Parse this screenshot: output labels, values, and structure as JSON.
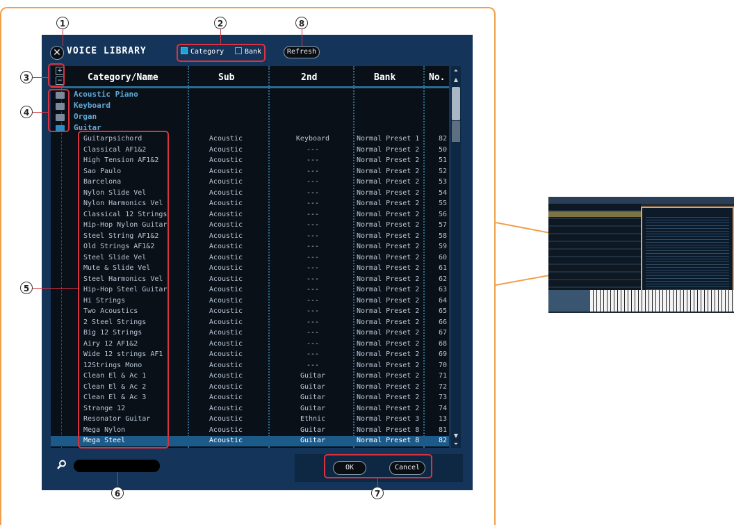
{
  "window": {
    "title": "VOICE LIBRARY",
    "close_glyph": "✕"
  },
  "filters": {
    "category_label": "Category",
    "category_checked": true,
    "bank_label": "Bank",
    "bank_checked": false
  },
  "refresh_label": "Refresh",
  "tree_controls": {
    "expand": "+",
    "collapse": "−"
  },
  "columns": [
    "Category/Name",
    "Sub",
    "2nd",
    "Bank",
    "No."
  ],
  "categories": [
    "Acoustic Piano",
    "Keyboard",
    "Organ",
    "Guitar"
  ],
  "rows": [
    {
      "name": "Guitarpsichord",
      "sub": "Acoustic",
      "second": "Keyboard",
      "bank": "Normal Preset 1",
      "no": "82"
    },
    {
      "name": "Classical AF1&2",
      "sub": "Acoustic",
      "second": "---",
      "bank": "Normal Preset 2",
      "no": "50"
    },
    {
      "name": "High Tension AF1&2",
      "sub": "Acoustic",
      "second": "---",
      "bank": "Normal Preset 2",
      "no": "51"
    },
    {
      "name": "Sao Paulo",
      "sub": "Acoustic",
      "second": "---",
      "bank": "Normal Preset 2",
      "no": "52"
    },
    {
      "name": "Barcelona",
      "sub": "Acoustic",
      "second": "---",
      "bank": "Normal Preset 2",
      "no": "53"
    },
    {
      "name": "Nylon Slide Vel",
      "sub": "Acoustic",
      "second": "---",
      "bank": "Normal Preset 2",
      "no": "54"
    },
    {
      "name": "Nylon Harmonics Vel",
      "sub": "Acoustic",
      "second": "---",
      "bank": "Normal Preset 2",
      "no": "55"
    },
    {
      "name": "Classical 12 Strings",
      "sub": "Acoustic",
      "second": "---",
      "bank": "Normal Preset 2",
      "no": "56"
    },
    {
      "name": "Hip-Hop Nylon Guitar",
      "sub": "Acoustic",
      "second": "---",
      "bank": "Normal Preset 2",
      "no": "57"
    },
    {
      "name": "Steel String AF1&2",
      "sub": "Acoustic",
      "second": "---",
      "bank": "Normal Preset 2",
      "no": "58"
    },
    {
      "name": "Old Strings AF1&2",
      "sub": "Acoustic",
      "second": "---",
      "bank": "Normal Preset 2",
      "no": "59"
    },
    {
      "name": "Steel Slide Vel",
      "sub": "Acoustic",
      "second": "---",
      "bank": "Normal Preset 2",
      "no": "60"
    },
    {
      "name": "Mute & Slide Vel",
      "sub": "Acoustic",
      "second": "---",
      "bank": "Normal Preset 2",
      "no": "61"
    },
    {
      "name": "Steel Harmonics Vel",
      "sub": "Acoustic",
      "second": "---",
      "bank": "Normal Preset 2",
      "no": "62"
    },
    {
      "name": "Hip-Hop Steel Guitar",
      "sub": "Acoustic",
      "second": "---",
      "bank": "Normal Preset 2",
      "no": "63"
    },
    {
      "name": "Hi Strings",
      "sub": "Acoustic",
      "second": "---",
      "bank": "Normal Preset 2",
      "no": "64"
    },
    {
      "name": "Two Acoustics",
      "sub": "Acoustic",
      "second": "---",
      "bank": "Normal Preset 2",
      "no": "65"
    },
    {
      "name": "2 Steel Strings",
      "sub": "Acoustic",
      "second": "---",
      "bank": "Normal Preset 2",
      "no": "66"
    },
    {
      "name": "Big 12 Strings",
      "sub": "Acoustic",
      "second": "---",
      "bank": "Normal Preset 2",
      "no": "67"
    },
    {
      "name": "Airy 12 AF1&2",
      "sub": "Acoustic",
      "second": "---",
      "bank": "Normal Preset 2",
      "no": "68"
    },
    {
      "name": "Wide 12 strings AF1",
      "sub": "Acoustic",
      "second": "---",
      "bank": "Normal Preset 2",
      "no": "69"
    },
    {
      "name": "12Strings Mono",
      "sub": "Acoustic",
      "second": "---",
      "bank": "Normal Preset 2",
      "no": "70"
    },
    {
      "name": "Clean El & Ac 1",
      "sub": "Acoustic",
      "second": "Guitar",
      "bank": "Normal Preset 2",
      "no": "71"
    },
    {
      "name": "Clean El & Ac 2",
      "sub": "Acoustic",
      "second": "Guitar",
      "bank": "Normal Preset 2",
      "no": "72"
    },
    {
      "name": "Clean El & Ac 3",
      "sub": "Acoustic",
      "second": "Guitar",
      "bank": "Normal Preset 2",
      "no": "73"
    },
    {
      "name": "Strange 12",
      "sub": "Acoustic",
      "second": "Guitar",
      "bank": "Normal Preset 2",
      "no": "74"
    },
    {
      "name": "Resonator Guitar",
      "sub": "Acoustic",
      "second": "Ethnic",
      "bank": "Normal Preset 3",
      "no": "13"
    },
    {
      "name": "Mega Nylon",
      "sub": "Acoustic",
      "second": "Guitar",
      "bank": "Normal Preset 8",
      "no": "81"
    },
    {
      "name": "Mega Steel",
      "sub": "Acoustic",
      "second": "Guitar",
      "bank": "Normal Preset 8",
      "no": "82"
    }
  ],
  "selected_row": "Mega Steel",
  "search": {
    "value": "",
    "placeholder": ""
  },
  "buttons": {
    "ok": "OK",
    "cancel": "Cancel"
  },
  "callouts": [
    "1",
    "2",
    "3",
    "4",
    "5",
    "6",
    "7",
    "8"
  ],
  "colors": {
    "accent_orange": "#f0a04b",
    "highlight_red": "#d9333f",
    "panel_blue": "#14345a",
    "selection_blue": "#1c5a8a"
  }
}
